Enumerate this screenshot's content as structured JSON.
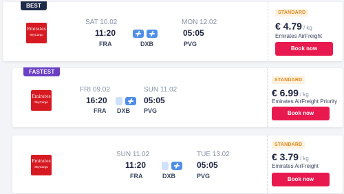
{
  "offers": [
    {
      "badge": "BEST",
      "logo": {
        "line1": "Emirates",
        "line2": "SkyCargo"
      },
      "dep_date": "SAT 10.02",
      "dep_time": "11:20",
      "origin": "FRA",
      "via": "DXB",
      "arr_date": "MON 12.02",
      "arr_time": "05:05",
      "dest": "PVG",
      "tier": "STANDARD",
      "price": "€ 4.79",
      "unit": "/ kg",
      "carrier": "Emirates AirFreight",
      "button": "Book now"
    },
    {
      "badge": "FASTEST",
      "logo": {
        "line1": "Emirates",
        "line2": "SkyCargo"
      },
      "dep_date": "FRI 09.02",
      "dep_time": "16:20",
      "origin": "FRA",
      "via": "DXB",
      "arr_date": "SUN 11.02",
      "arr_time": "05:05",
      "dest": "PVG",
      "tier": "STANDARD",
      "price": "€ 6.99",
      "unit": "/ kg",
      "carrier": "Emirates AirFreight Priority",
      "button": "Book now"
    },
    {
      "badge": "",
      "logo": {
        "line1": "Emirates",
        "line2": "SkyCargo"
      },
      "dep_date": "SUN 11.02",
      "dep_time": "11:20",
      "origin": "FRA",
      "via": "DXB",
      "arr_date": "TUE 13.02",
      "arr_time": "05:05",
      "dest": "PVG",
      "tier": "STANDARD",
      "price": "€ 3.79",
      "unit": "/ kg",
      "carrier": "Emirates AirFreight",
      "button": "Book now"
    }
  ],
  "colors": {
    "accent": "#e8194e",
    "best_badge": "#1e2a4a",
    "fastest_badge": "#6b3fc4",
    "route": "#4f8fe8",
    "tier": "#e08a1e"
  },
  "icons": {
    "segment": "plane-icon",
    "logo": "emirates-skycargo-logo"
  }
}
